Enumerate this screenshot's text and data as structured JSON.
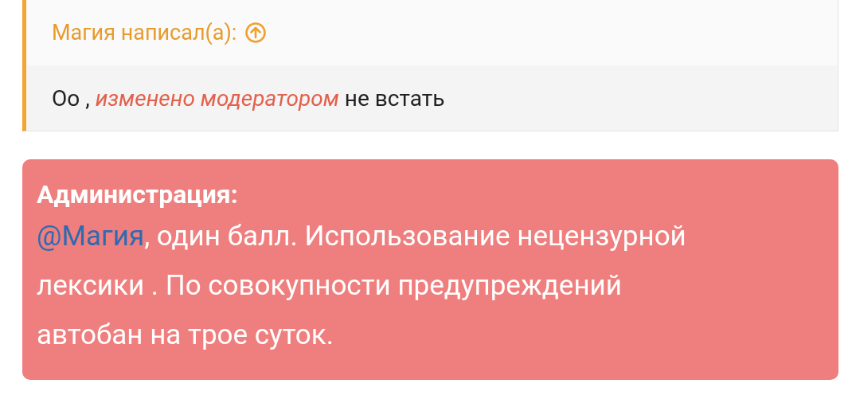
{
  "quote": {
    "author_line": "Магия написал(а):",
    "body": "Оо , *изменено модератором* не встать"
  },
  "notice": {
    "title": "Администрация:",
    "mention": "@Магия",
    "text": ", один балл. Использование нецензурной лексики . По совокупности предупреждений автобан на трое суток."
  }
}
